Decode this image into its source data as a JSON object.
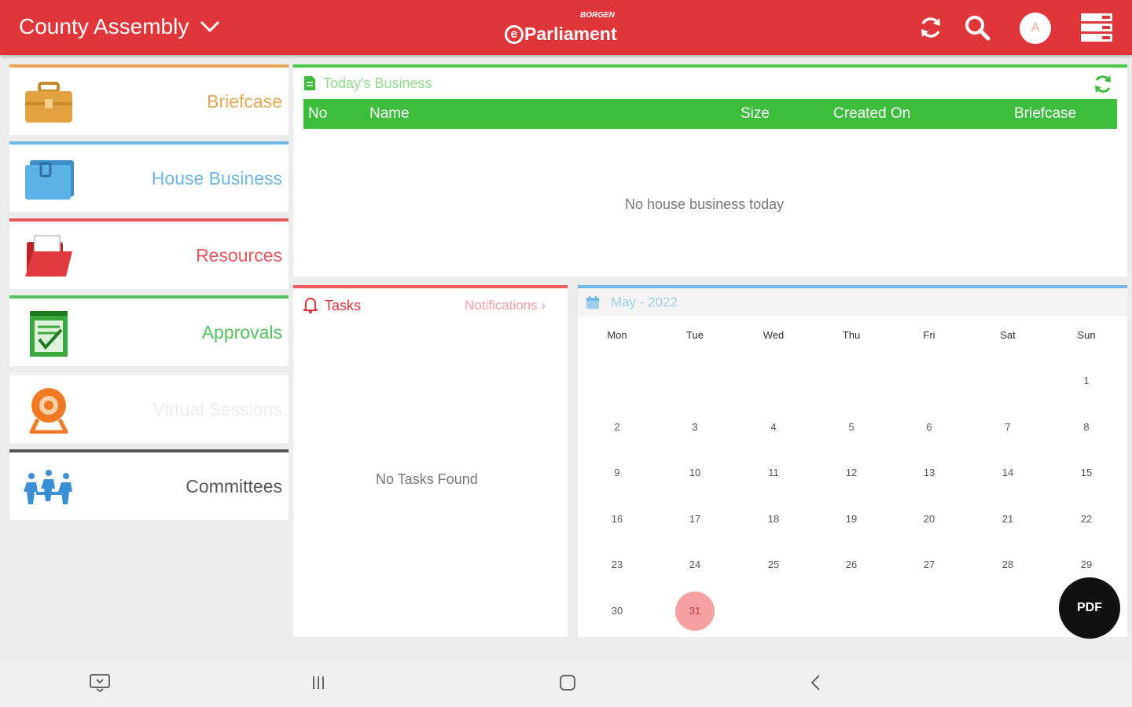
{
  "topbar": {
    "assembly_label": "County Assembly",
    "logo_small": "BORGEN",
    "logo_main": "Parliament",
    "logo_letter": "e",
    "avatar_initial": "A",
    "icons": [
      "sync-icon",
      "search-icon",
      "menu-icon"
    ]
  },
  "sidebar": {
    "items": [
      {
        "label": "Briefcase",
        "color": "#e8a657",
        "icon": "briefcase-icon"
      },
      {
        "label": "House Business",
        "color": "#6bb7e6",
        "icon": "folder-icon"
      },
      {
        "label": "Resources",
        "color": "#e8575b",
        "icon": "open-folder-icon"
      },
      {
        "label": "Approvals",
        "color": "#52c25a",
        "icon": "checklist-icon"
      },
      {
        "label": "Virtual Sessions",
        "color": "#f2f2f2",
        "icon": "webcam-icon"
      },
      {
        "label": "Committees",
        "color": "#555555",
        "icon": "people-icon"
      }
    ]
  },
  "business": {
    "title": "Today's Business",
    "columns": [
      "No",
      "Name",
      "Size",
      "Created On",
      "Briefcase"
    ],
    "empty": "No house business today"
  },
  "tasks": {
    "title": "Tasks",
    "notifications_link": "Notifications ›",
    "empty": "No Tasks Found"
  },
  "calendar": {
    "title": "May - 2022",
    "weekdays": [
      "Mon",
      "Tue",
      "Wed",
      "Thu",
      "Fri",
      "Sat",
      "Sun"
    ],
    "weeks": [
      [
        "",
        "",
        "",
        "",
        "",
        "",
        "1"
      ],
      [
        "2",
        "3",
        "4",
        "5",
        "6",
        "7",
        "8"
      ],
      [
        "9",
        "10",
        "11",
        "12",
        "13",
        "14",
        "15"
      ],
      [
        "16",
        "17",
        "18",
        "19",
        "20",
        "21",
        "22"
      ],
      [
        "23",
        "24",
        "25",
        "26",
        "27",
        "28",
        "29"
      ],
      [
        "30",
        "31",
        "",
        "",
        "",
        "",
        ""
      ]
    ],
    "selected_day": "31"
  },
  "fab": {
    "label": "PDF"
  },
  "colors": {
    "accent": "#e0363a",
    "green": "#3dbd3c",
    "blue": "#70b6e8"
  }
}
